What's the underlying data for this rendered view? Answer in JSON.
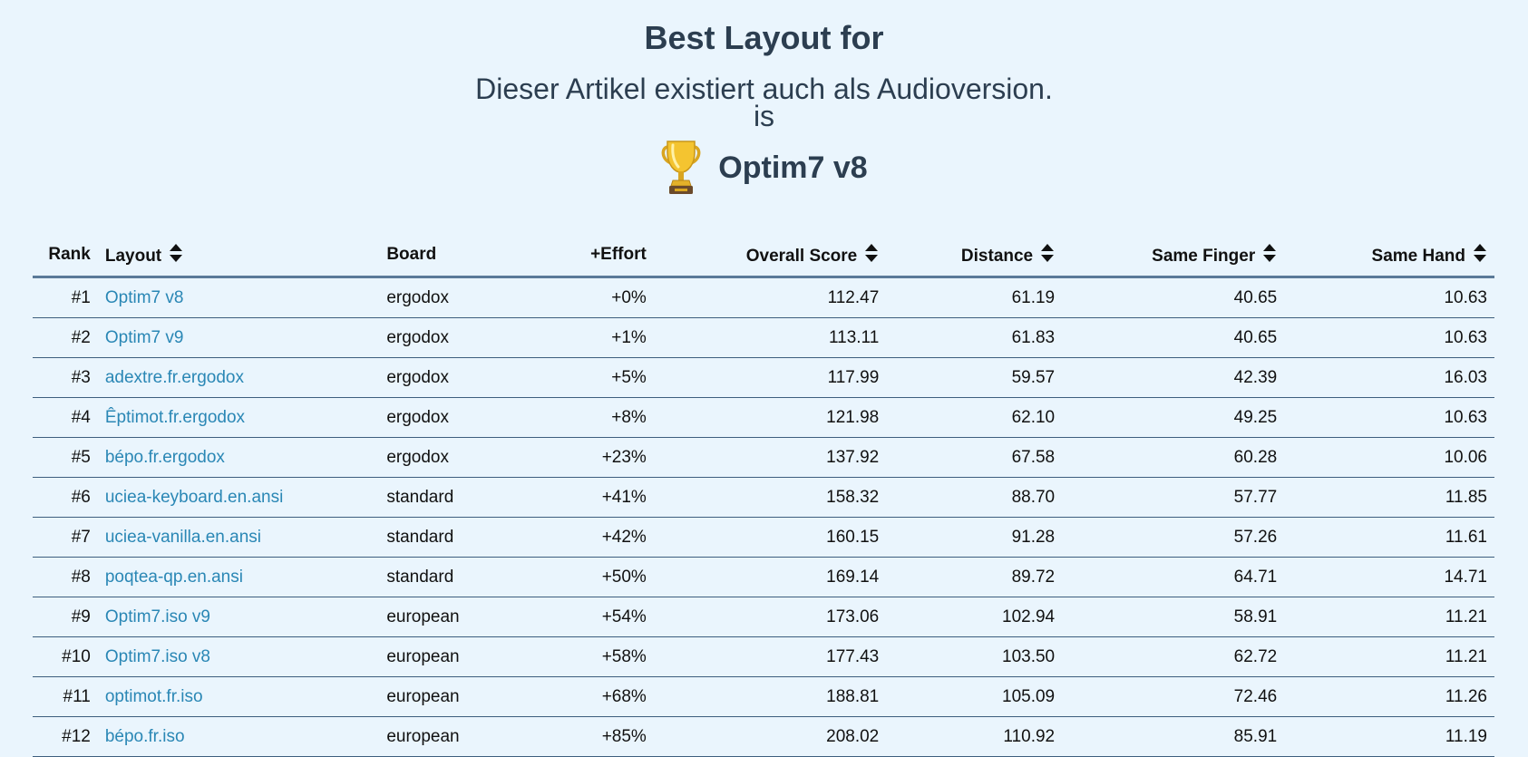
{
  "header": {
    "title": "Best Layout for",
    "subtitle": "Dieser Artikel existiert auch als Audioversion.",
    "connector": "is",
    "winner_icon": "trophy-icon",
    "winner": "Optim7 v8"
  },
  "table": {
    "columns": {
      "rank": "Rank",
      "layout": "Layout",
      "board": "Board",
      "effort": "+Effort",
      "score": "Overall Score",
      "distance": "Distance",
      "same_finger": "Same Finger",
      "same_hand": "Same Hand"
    },
    "rows": [
      {
        "rank": "#1",
        "layout": "Optim7 v8",
        "board": "ergodox",
        "effort": "+0%",
        "score": "112.47",
        "distance": "61.19",
        "same_finger": "40.65",
        "same_hand": "10.63"
      },
      {
        "rank": "#2",
        "layout": "Optim7 v9",
        "board": "ergodox",
        "effort": "+1%",
        "score": "113.11",
        "distance": "61.83",
        "same_finger": "40.65",
        "same_hand": "10.63"
      },
      {
        "rank": "#3",
        "layout": "adextre.fr.ergodox",
        "board": "ergodox",
        "effort": "+5%",
        "score": "117.99",
        "distance": "59.57",
        "same_finger": "42.39",
        "same_hand": "16.03"
      },
      {
        "rank": "#4",
        "layout": "Êptimot.fr.ergodox",
        "board": "ergodox",
        "effort": "+8%",
        "score": "121.98",
        "distance": "62.10",
        "same_finger": "49.25",
        "same_hand": "10.63"
      },
      {
        "rank": "#5",
        "layout": "bépo.fr.ergodox",
        "board": "ergodox",
        "effort": "+23%",
        "score": "137.92",
        "distance": "67.58",
        "same_finger": "60.28",
        "same_hand": "10.06"
      },
      {
        "rank": "#6",
        "layout": "uciea-keyboard.en.ansi",
        "board": "standard",
        "effort": "+41%",
        "score": "158.32",
        "distance": "88.70",
        "same_finger": "57.77",
        "same_hand": "11.85"
      },
      {
        "rank": "#7",
        "layout": "uciea-vanilla.en.ansi",
        "board": "standard",
        "effort": "+42%",
        "score": "160.15",
        "distance": "91.28",
        "same_finger": "57.26",
        "same_hand": "11.61"
      },
      {
        "rank": "#8",
        "layout": "poqtea-qp.en.ansi",
        "board": "standard",
        "effort": "+50%",
        "score": "169.14",
        "distance": "89.72",
        "same_finger": "64.71",
        "same_hand": "14.71"
      },
      {
        "rank": "#9",
        "layout": "Optim7.iso v9",
        "board": "european",
        "effort": "+54%",
        "score": "173.06",
        "distance": "102.94",
        "same_finger": "58.91",
        "same_hand": "11.21"
      },
      {
        "rank": "#10",
        "layout": "Optim7.iso v8",
        "board": "european",
        "effort": "+58%",
        "score": "177.43",
        "distance": "103.50",
        "same_finger": "62.72",
        "same_hand": "11.21"
      },
      {
        "rank": "#11",
        "layout": "optimot.fr.iso",
        "board": "european",
        "effort": "+68%",
        "score": "188.81",
        "distance": "105.09",
        "same_finger": "72.46",
        "same_hand": "11.26"
      },
      {
        "rank": "#12",
        "layout": "bépo.fr.iso",
        "board": "european",
        "effort": "+85%",
        "score": "208.02",
        "distance": "110.92",
        "same_finger": "85.91",
        "same_hand": "11.19"
      }
    ]
  },
  "theme": {
    "background": "#eaf5fd",
    "heading": "#2c3e50",
    "link": "#2a87b5",
    "row_border": "#3d5e7e"
  },
  "icons": {
    "sort": "sort-icon",
    "trophy": "trophy-icon"
  }
}
